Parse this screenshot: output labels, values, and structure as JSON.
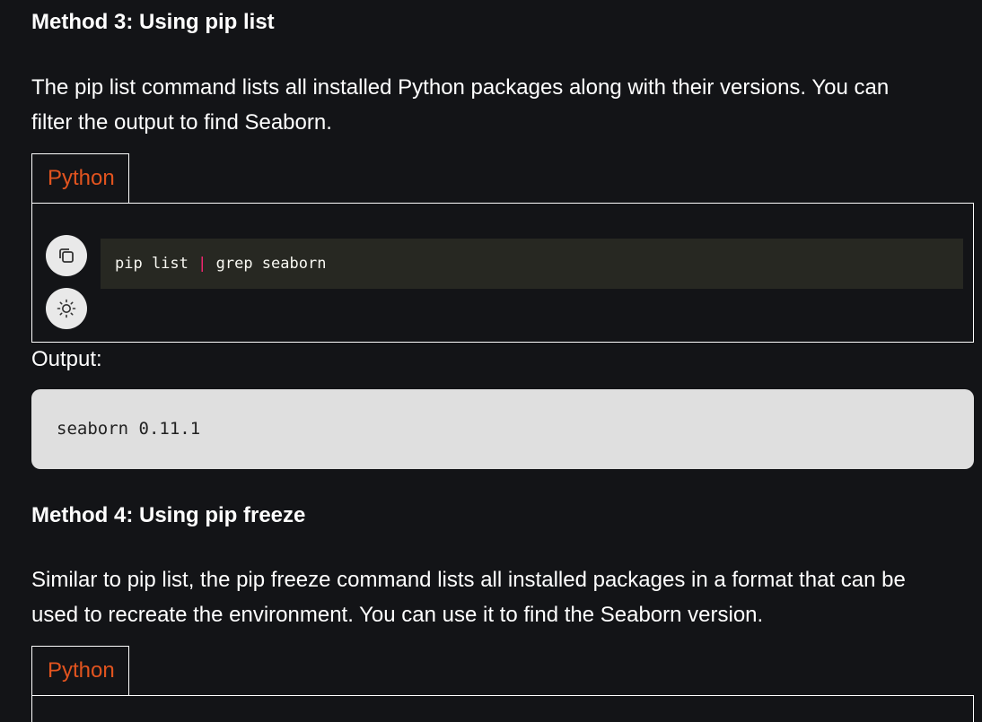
{
  "method3": {
    "heading": "Method 3: Using pip list",
    "paragraph_line1": "The pip list command lists all installed Python packages along with their versions. You can",
    "paragraph_line2": "filter the output to find Seaborn.",
    "tab_label": "Python",
    "code": {
      "part1": "pip list ",
      "pipe": "|",
      "part2": " grep seaborn"
    },
    "output_label": "Output:",
    "output_text": "seaborn 0.11.1"
  },
  "method4": {
    "heading": "Method 4: Using pip freeze",
    "paragraph_line1": "Similar to pip list, the pip freeze command lists all installed packages in a format that can be",
    "paragraph_line2": "used to recreate the environment. You can use it to find the Seaborn version.",
    "tab_label": "Python"
  },
  "icons": {
    "copy": "copy-icon",
    "theme": "sun-icon"
  },
  "colors": {
    "background": "#131417",
    "tab_text": "#e2541f",
    "code_bg": "#272822",
    "pipe": "#f92672",
    "output_bg": "#dfdfdf",
    "icon_button_bg": "#e9e9e9"
  }
}
